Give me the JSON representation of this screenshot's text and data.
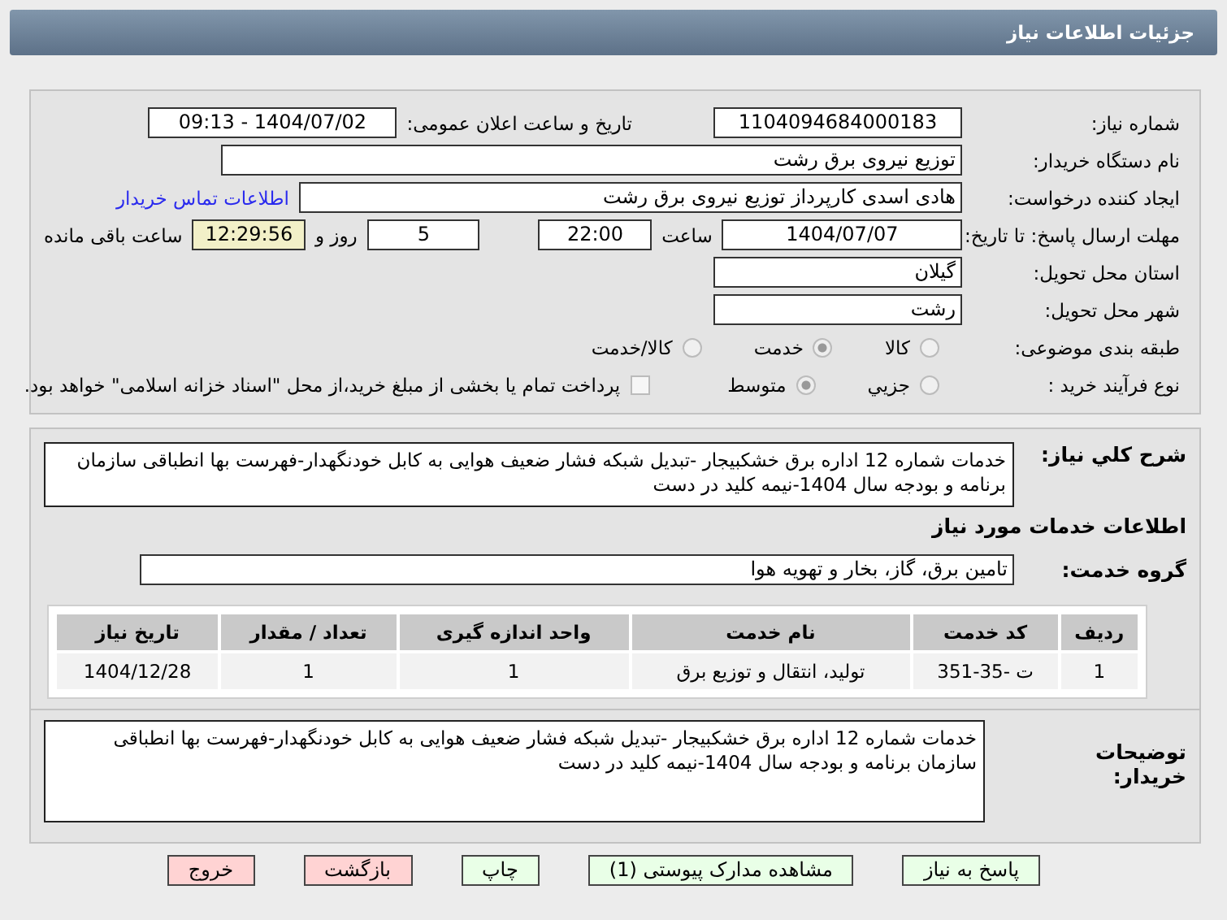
{
  "header": {
    "title": "جزئیات اطلاعات نیاز"
  },
  "details": {
    "need_number": {
      "label": "شماره نیاز:",
      "value": "1104094684000183"
    },
    "announce": {
      "label": "تاریخ و ساعت اعلان عمومی:",
      "value": "1404/07/02 - 09:13"
    },
    "buyer": {
      "label": "نام دستگاه خریدار:",
      "value": "توزیع نیروی برق رشت"
    },
    "creator": {
      "label": "ایجاد کننده درخواست:",
      "value": "هادی  اسدی کارپرداز توزیع نیروی برق رشت",
      "link": "اطلاعات تماس خریدار"
    },
    "deadline": {
      "label": "مهلت ارسال پاسخ: تا تاریخ:",
      "date": "1404/07/07",
      "time_label": "ساعت",
      "time": "22:00",
      "days": "5",
      "days_label": "روز و",
      "remaining": "12:29:56",
      "remaining_label": "ساعت باقی مانده"
    },
    "province": {
      "label": "استان محل تحویل:",
      "value": "گیلان"
    },
    "city": {
      "label": "شهر محل تحویل:",
      "value": "رشت"
    },
    "category": {
      "label": "طبقه بندی موضوعی:",
      "options": [
        {
          "label": "کالا",
          "selected": false
        },
        {
          "label": "خدمت",
          "selected": true
        },
        {
          "label": "کالا/خدمت",
          "selected": false
        }
      ]
    },
    "process": {
      "label": "نوع فرآیند خرید :",
      "options": [
        {
          "label": "جزيي",
          "selected": false
        },
        {
          "label": "متوسط",
          "selected": true
        }
      ],
      "payment": {
        "checked": false,
        "text": "پرداخت تمام یا بخشی از مبلغ خرید،از محل \"اسناد خزانه اسلامی\" خواهد بود."
      }
    }
  },
  "services": {
    "summary": {
      "label": "شرح کلي نیاز:",
      "value": "خدمات شماره 12 اداره برق خشکبیجار -تبدیل شبکه فشار ضعیف هوایی به کابل خودنگهدار-فهرست بها انطباقی سازمان برنامه و بودجه سال 1404-نیمه کلید در دست"
    },
    "heading": "اطلاعات خدمات مورد نیاز",
    "group": {
      "label": "گروه خدمت:",
      "value": "تامین برق، گاز، بخار و تهویه هوا"
    },
    "table": {
      "columns": [
        "ردیف",
        "کد خدمت",
        "نام خدمت",
        "واحد اندازه گیری",
        "تعداد / مقدار",
        "تاریخ نیاز"
      ],
      "rows": [
        [
          "1",
          "ت -35-351",
          "تولید، انتقال و توزیع برق",
          "1",
          "1",
          "1404/12/28"
        ]
      ]
    }
  },
  "buyer_notes": {
    "label": "توضیحات خریدار:",
    "value": "خدمات شماره 12 اداره برق خشکبیجار -تبدیل شبکه فشار ضعیف هوایی به کابل خودنگهدار-فهرست بها انطباقی سازمان برنامه و بودجه سال 1404-نیمه کلید در دست"
  },
  "buttons": [
    {
      "label": "پاسخ به نیاز",
      "kind": "primary"
    },
    {
      "label": "مشاهده مدارک پیوستی (1)",
      "kind": "primary"
    },
    {
      "label": "چاپ",
      "kind": "primary"
    },
    {
      "label": "بازگشت",
      "kind": "danger"
    },
    {
      "label": "خروج",
      "kind": "danger"
    }
  ]
}
